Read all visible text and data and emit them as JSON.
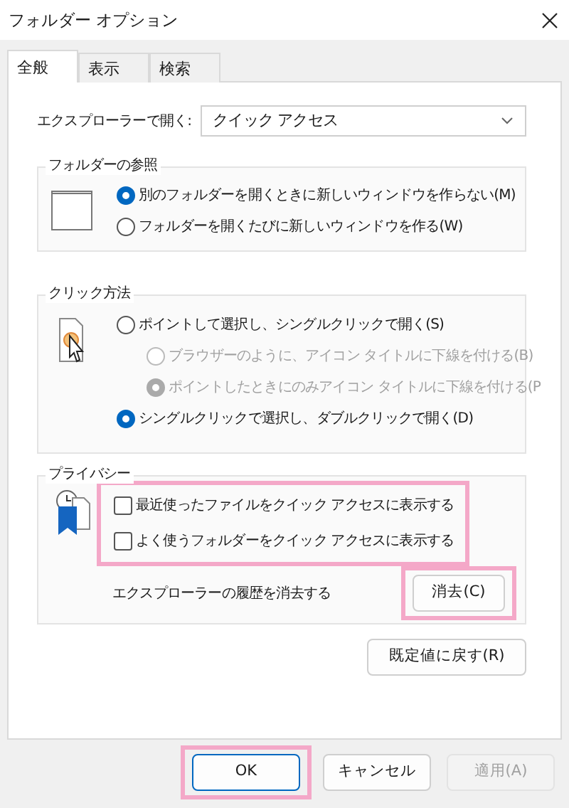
{
  "window": {
    "title": "フォルダー オプション"
  },
  "tabs": [
    {
      "label": "全般",
      "selected": true
    },
    {
      "label": "表示",
      "selected": false
    },
    {
      "label": "検索",
      "selected": false
    }
  ],
  "open_with": {
    "label": "エクスプローラーで開く:",
    "value": "クイック アクセス"
  },
  "browse_folders": {
    "title": "フォルダーの参照",
    "options": [
      {
        "label": "別のフォルダーを開くときに新しいウィンドウを作らない(M)",
        "selected": true,
        "disabled": false
      },
      {
        "label": "フォルダーを開くたびに新しいウィンドウを作る(W)",
        "selected": false,
        "disabled": false
      }
    ]
  },
  "click_method": {
    "title": "クリック方法",
    "options": [
      {
        "label": "ポイントして選択し、シングルクリックで開く(S)",
        "selected": false,
        "disabled": false,
        "children": [
          {
            "label": "ブラウザーのように、アイコン タイトルに下線を付ける(B)",
            "selected": false,
            "disabled": true
          },
          {
            "label": "ポイントしたときにのみアイコン タイトルに下線を付ける(P",
            "selected": true,
            "disabled": true
          }
        ]
      },
      {
        "label": "シングルクリックで選択し、ダブルクリックで開く(D)",
        "selected": true,
        "disabled": false
      }
    ]
  },
  "privacy": {
    "title": "プライバシー",
    "highlighted": true,
    "checkboxes": [
      {
        "label": "最近使ったファイルをクイック アクセスに表示する",
        "checked": false
      },
      {
        "label": "よく使うフォルダーをクイック アクセスに表示する",
        "checked": false
      }
    ],
    "clear_label": "エクスプローラーの履歴を消去する",
    "clear_button": {
      "label": "消去(C)",
      "highlighted": true
    }
  },
  "reset_button": "既定値に戻す(R)",
  "buttons": [
    {
      "label": "OK",
      "default": true,
      "disabled": false,
      "highlighted": true
    },
    {
      "label": "キャンセル",
      "default": false,
      "disabled": false,
      "highlighted": false
    },
    {
      "label": "適用(A)",
      "default": false,
      "disabled": true,
      "highlighted": false
    }
  ]
}
